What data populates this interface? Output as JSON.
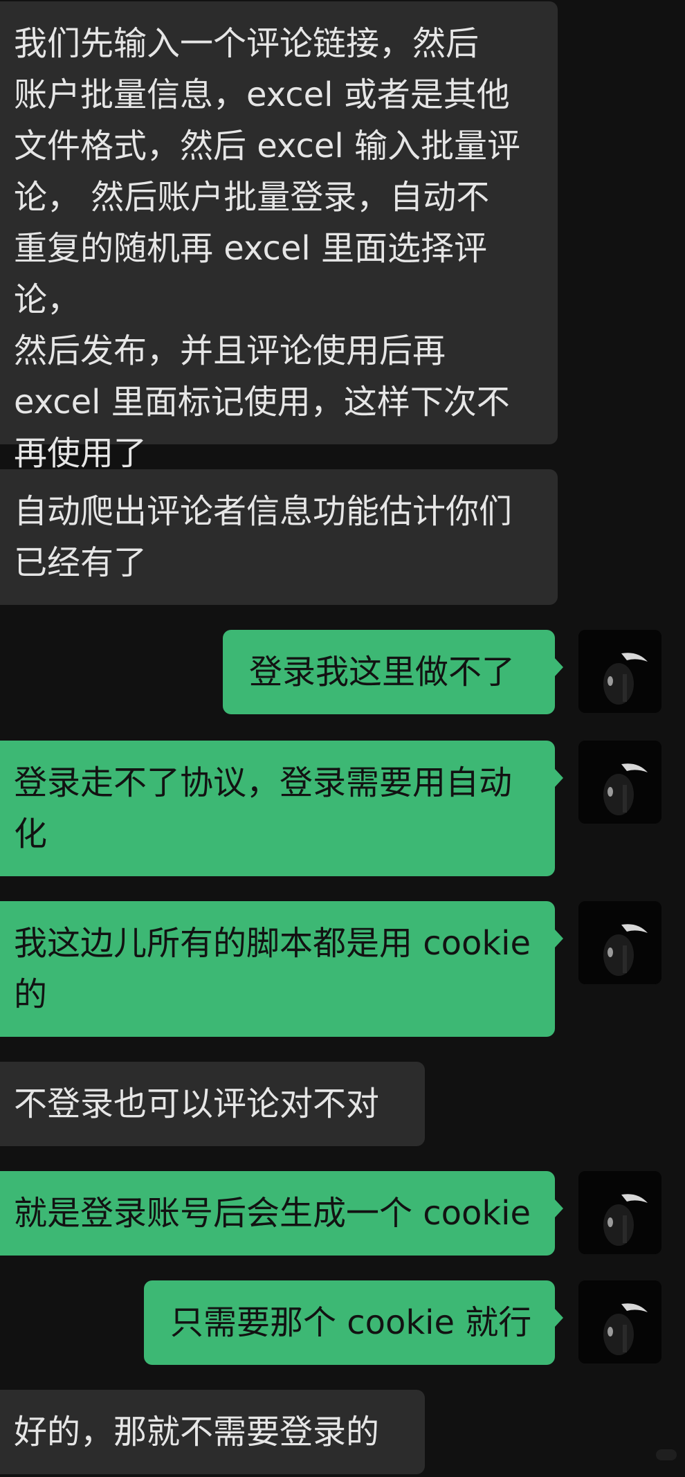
{
  "messages": [
    {
      "direction": "incoming",
      "text": "我们先输入一个评论链接，然后\n账户批量信息，excel 或者是其他\n文件格式，然后 excel 输入批量评\n论， 然后账户批量登录，自动不\n重复的随机再 excel 里面选择评论，\n然后发布，并且评论使用后再\nexcel 里面标记使用，这样下次不\n再使用了"
    },
    {
      "direction": "incoming",
      "text": "自动爬出评论者信息功能估计你们\n已经有了"
    },
    {
      "direction": "outgoing",
      "text": "登录我这里做不了"
    },
    {
      "direction": "outgoing",
      "text": "登录走不了协议，登录需要用自动\n化"
    },
    {
      "direction": "outgoing",
      "text": "我这边儿所有的脚本都是用 cookie\n的"
    },
    {
      "direction": "incoming",
      "text": "不登录也可以评论对不对"
    },
    {
      "direction": "outgoing",
      "text": "就是登录账号后会生成一个 cookie"
    },
    {
      "direction": "outgoing",
      "text": "只需要那个 cookie 就行"
    },
    {
      "direction": "incoming",
      "text": "好的，那就不需要登录的"
    }
  ],
  "colors": {
    "background": "#111111",
    "incoming_bubble": "#2c2c2c",
    "outgoing_bubble": "#3db874"
  },
  "icons": {
    "avatar": "avatar-icon"
  }
}
